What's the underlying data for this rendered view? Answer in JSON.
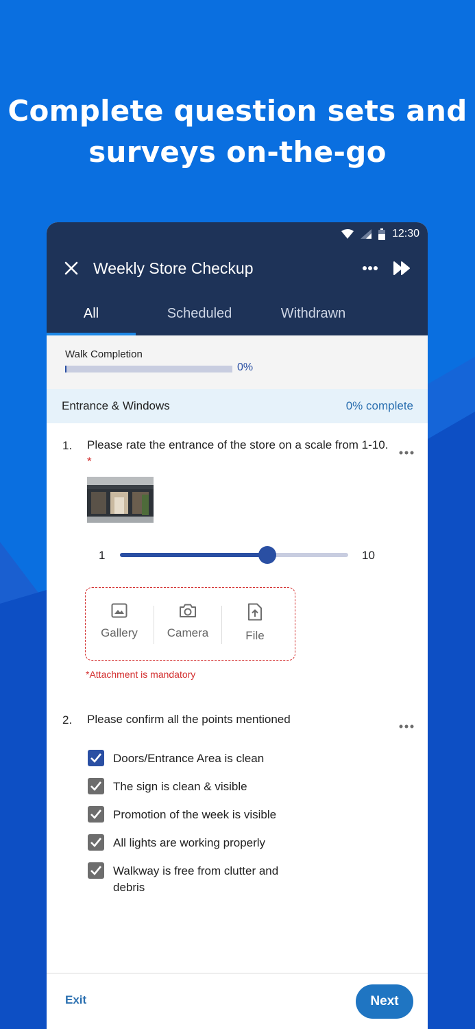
{
  "hero": {
    "headline_line1": "Complete question sets and",
    "headline_line2": "surveys on-the-go"
  },
  "colors": {
    "brand_blue": "#0a6fe0",
    "appbar": "#1e3358",
    "accent": "#2a4fa3",
    "error": "#d32f2f",
    "next_button": "#1f75c2"
  },
  "status_bar": {
    "time": "12:30",
    "icons": [
      "wifi-icon",
      "signal-icon",
      "battery-icon"
    ]
  },
  "toolbar": {
    "title": "Weekly Store Checkup",
    "icons": [
      "close-icon",
      "more-horizontal-icon",
      "fast-forward-icon"
    ]
  },
  "tabs": [
    {
      "label": "All",
      "active": true
    },
    {
      "label": "Scheduled",
      "active": false
    },
    {
      "label": "Withdrawn",
      "active": false
    }
  ],
  "walk": {
    "label": "Walk Completion",
    "percent_text": "0%",
    "progress": 0
  },
  "section": {
    "title": "Entrance & Windows",
    "completion": "0% complete"
  },
  "question1": {
    "number": "1.",
    "text": "Please rate the entrance of the store on a scale from 1-10.",
    "required_mark": "*",
    "slider": {
      "min": "1",
      "max": "10",
      "value_fraction": 0.645
    },
    "attachments": {
      "gallery": "Gallery",
      "camera": "Camera",
      "file": "File",
      "error": "*Attachment is mandatory"
    }
  },
  "question2": {
    "number": "2.",
    "text": "Please confirm all the points mentioned",
    "items": [
      {
        "label": "Doors/Entrance Area is clean",
        "checked": true
      },
      {
        "label": "The sign is clean & visible",
        "checked": true
      },
      {
        "label": "Promotion of the week is visible",
        "checked": true
      },
      {
        "label": "All lights are working properly",
        "checked": true
      },
      {
        "label": "Walkway is free from clutter and debris",
        "checked": true
      }
    ]
  },
  "footer": {
    "exit_label": "Exit",
    "next_label": "Next"
  }
}
